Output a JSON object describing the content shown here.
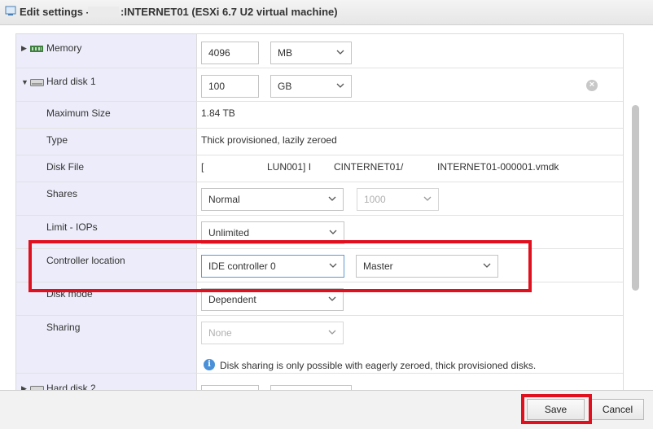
{
  "window": {
    "title_prefix": "Edit settings -",
    "title_rest": ":INTERNET01 (ESXi 6.7 U2 virtual machine)"
  },
  "memory": {
    "label": "Memory",
    "value": "4096",
    "unit": "MB"
  },
  "hard_disk_1": {
    "label": "Hard disk 1",
    "value": "100",
    "unit": "GB"
  },
  "details": {
    "max_size_label": "Maximum Size",
    "max_size_value": "1.84 TB",
    "type_label": "Type",
    "type_value": "Thick provisioned, lazily zeroed",
    "disk_file_label": "Disk File",
    "disk_file_part1": "[",
    "disk_file_part2": "LUN001] I",
    "disk_file_part3": "CINTERNET01/",
    "disk_file_part4": "INTERNET01-000001.vmdk",
    "shares_label": "Shares",
    "shares_value": "Normal",
    "shares_number": "1000",
    "limit_label": "Limit - IOPs",
    "limit_value": "Unlimited",
    "controller_label": "Controller location",
    "controller_value": "IDE controller 0",
    "controller_position": "Master",
    "disk_mode_label": "Disk mode",
    "disk_mode_value": "Dependent",
    "sharing_label": "Sharing",
    "sharing_value": "None",
    "sharing_info": "Disk sharing is only possible with eagerly zeroed, thick provisioned disks."
  },
  "hard_disk_2": {
    "label": "Hard disk 2"
  },
  "footer": {
    "save_label": "Save",
    "cancel_label": "Cancel"
  },
  "colors": {
    "highlight": "#e0101e",
    "left_column": "#ececfa",
    "info": "#4a90d9"
  },
  "icons": [
    "vm-settings-icon",
    "memory-chip-icon",
    "hard-disk-icon",
    "chevron-down-icon",
    "info-icon",
    "remove-icon"
  ]
}
